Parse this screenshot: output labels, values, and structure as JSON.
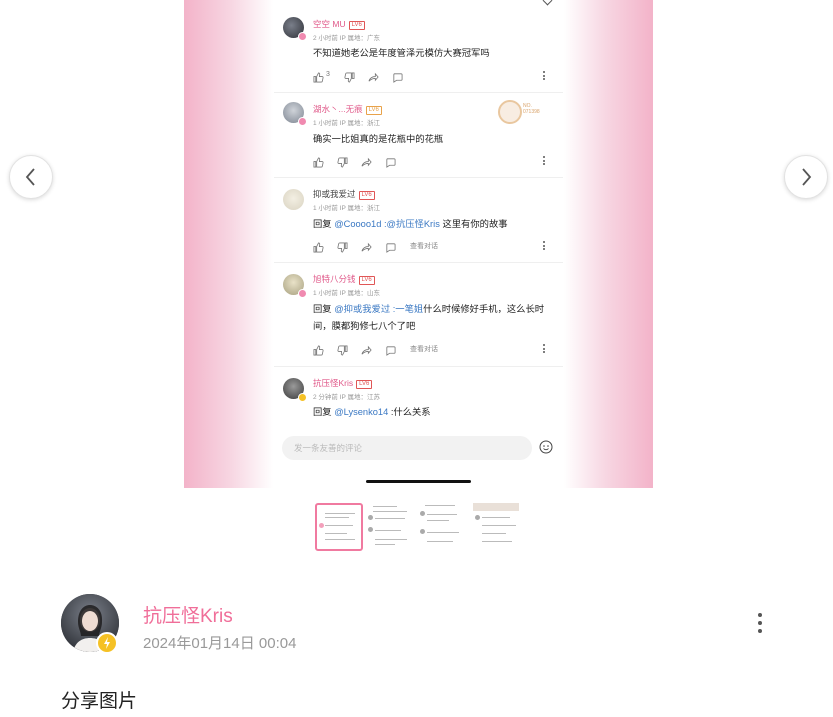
{
  "comments": [
    {
      "user": "空空 MU",
      "level": "LV6",
      "meta": "2 小时前  IP 属地：广东",
      "text": "不知道她老公是年度管泽元模仿大赛冠军吗",
      "likes": "3",
      "user_color": "#e05a8a"
    },
    {
      "user": "湖水丶...无痕",
      "level": "LV6",
      "meta": "1 小时前  IP 属地：浙江",
      "text": "确实一比姐真的是花瓶中的花瓶",
      "likes": "",
      "user_color": "#e05a8a",
      "decoration": "NO. 071398"
    },
    {
      "user": "抑或我爱过",
      "level": "LV6",
      "meta": "1 小时前  IP 属地：浙江",
      "reply_prefix": "回复 ",
      "mention": "@Coooo1d :@抗压怪Kris",
      "text": " 这里有你的故事",
      "view_conv": "查看对话",
      "user_color": "#444444"
    },
    {
      "user": "旭特八分钱",
      "level": "LV6",
      "meta": "1 小时前  IP 属地：山东",
      "reply_prefix": "回复 ",
      "mention": "@抑或我爱过 :一笔姐",
      "text": "什么时候修好手机，这么长时间，膜都狗修七八个了吧",
      "view_conv": "查看对话",
      "user_color": "#e05a8a"
    },
    {
      "user": "抗压怪Kris",
      "level": "LV6",
      "meta": "2 分钟前  IP 属地：江苏",
      "reply_prefix": "回复 ",
      "mention": "@Lysenko14",
      "text": " :什么关系",
      "user_color": "#e05a8a"
    }
  ],
  "input_placeholder": "发一条友善的评论",
  "post": {
    "author": "抗压怪Kris",
    "date": "2024年01月14日 00:04",
    "text": "分享图片"
  },
  "colors": {
    "accent": "#f06e99",
    "mention": "#3a78c3",
    "badge": "#f5c125"
  },
  "icons": [
    "chevron-left-icon",
    "chevron-right-icon",
    "thumb-up-icon",
    "thumb-down-icon",
    "share-icon",
    "comment-icon",
    "more-icon",
    "emoji-icon"
  ]
}
